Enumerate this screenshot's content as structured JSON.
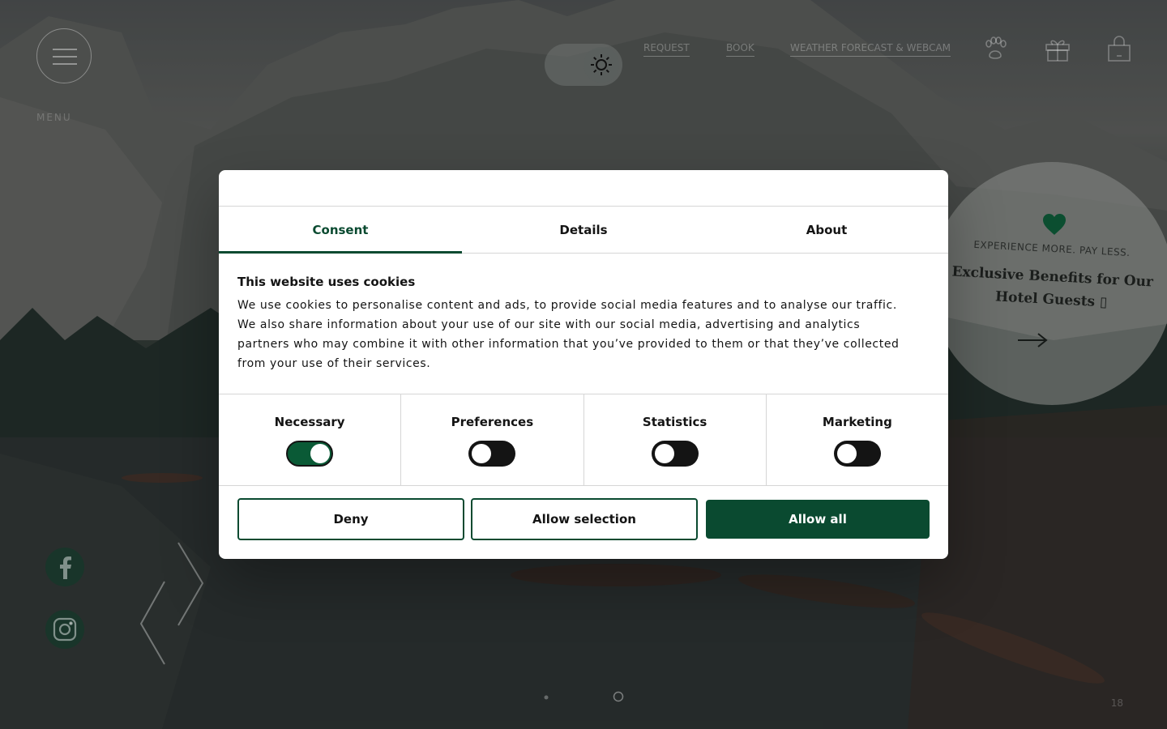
{
  "header": {
    "menu_text": "MENU",
    "nav": [
      {
        "label": "REQUEST"
      },
      {
        "label": "BOOK"
      },
      {
        "label": "WEATHER FORECAST & WEBCAM"
      }
    ],
    "icons": [
      "paw-icon",
      "gift-icon",
      "shopping-bag-icon"
    ]
  },
  "badge": {
    "tag": "EXPERIENCE MORE. PAY LESS.",
    "title": "Exclusive Benefits for Our Hotel Guests ▯"
  },
  "slider": {
    "page_number": "18"
  },
  "cookie_dialog": {
    "tabs": [
      {
        "label": "Consent",
        "active": true
      },
      {
        "label": "Details",
        "active": false
      },
      {
        "label": "About",
        "active": false
      }
    ],
    "heading": "This website uses cookies",
    "text": "We use cookies to personalise content and ads, to provide social media features and to analyse our traffic. We also share information about your use of our site with our social media, advertising and analytics partners who may combine it with other information that you’ve provided to them or that they’ve collected from your use of their services.",
    "categories": [
      {
        "label": "Necessary",
        "enabled": true
      },
      {
        "label": "Preferences",
        "enabled": false
      },
      {
        "label": "Statistics",
        "enabled": false
      },
      {
        "label": "Marketing",
        "enabled": false
      }
    ],
    "buttons": {
      "deny": "Deny",
      "allow_selection": "Allow selection",
      "allow_all": "Allow all"
    }
  },
  "colors": {
    "accent": "#0a4a30",
    "switch_on": "#0a5a36"
  }
}
